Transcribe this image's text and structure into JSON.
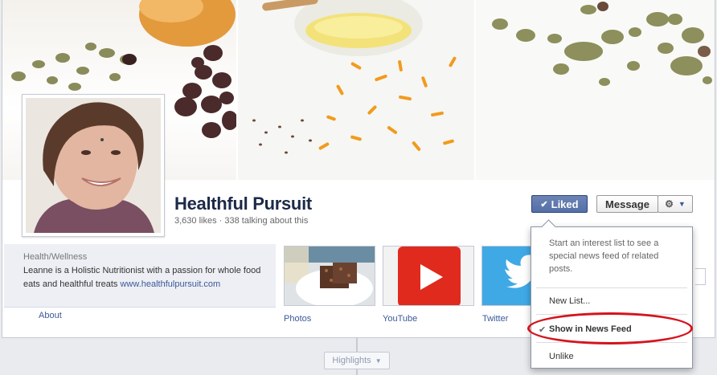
{
  "page": {
    "name": "Healthful Pursuit",
    "stats": "3,630 likes · 338 talking about this"
  },
  "actions": {
    "liked_label": "Liked",
    "message_label": "Message"
  },
  "info": {
    "category": "Health/Wellness",
    "description": "Leanne is a Holistic Nutritionist with a passion for whole food eats and healthful treats",
    "website": "www.healthfulpursuit.com",
    "about_label": "About"
  },
  "apps": [
    {
      "label": "Photos"
    },
    {
      "label": "YouTube"
    },
    {
      "label": "Twitter"
    }
  ],
  "dropdown": {
    "description": "Start an interest list to see a special news feed of related posts.",
    "new_list": "New List...",
    "show_in_news_feed": "Show in News Feed",
    "unlike": "Unlike"
  },
  "timeline": {
    "highlights_label": "Highlights"
  },
  "colors": {
    "facebook_blue": "#3b5998",
    "liked_button": "#5b74a8",
    "annotation_red": "#d4141d",
    "youtube_red": "#e02a1e",
    "twitter_blue": "#3fa9e6"
  }
}
